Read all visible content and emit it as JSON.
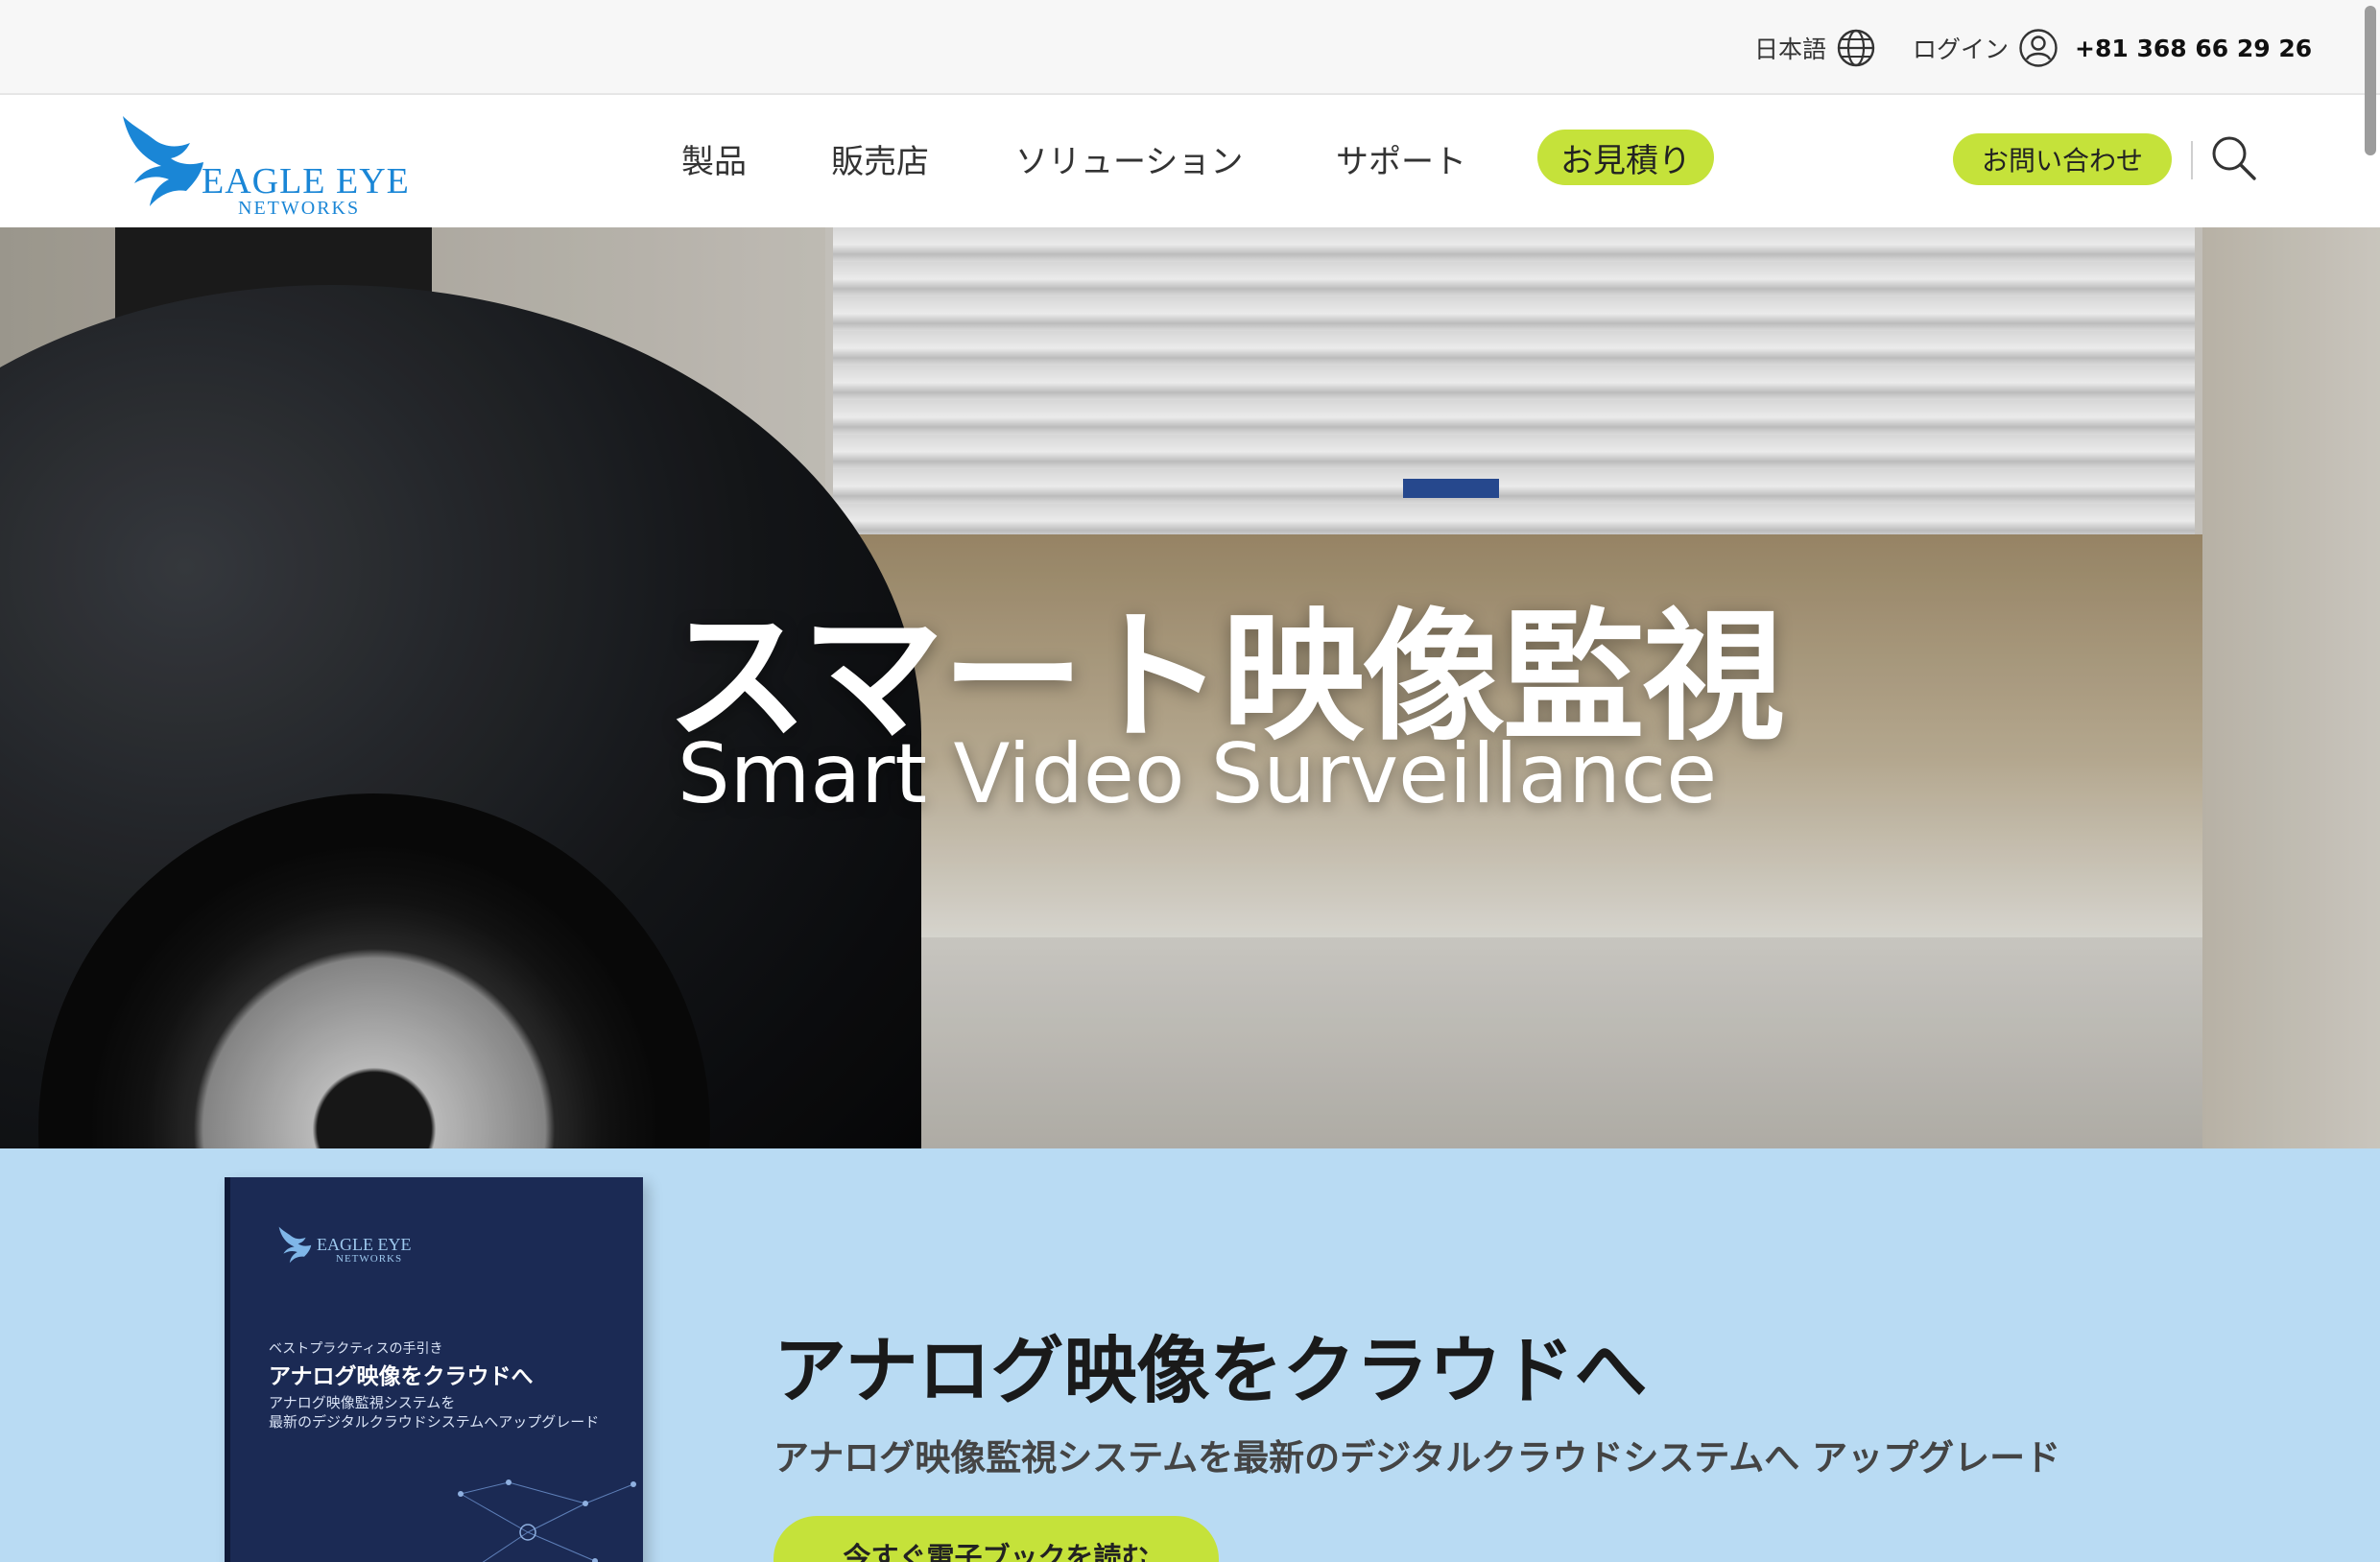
{
  "utility": {
    "language": "日本語",
    "login": "ログイン",
    "phone": "+81 368 66 29 26"
  },
  "brand": {
    "line1": "EAGLE EYE",
    "line2": "NETWORKS",
    "color": "#1a86d6"
  },
  "nav": {
    "items": [
      "製品",
      "販売店",
      "ソリューション",
      "サポート"
    ],
    "quote": "お見積り",
    "contact": "お問い合わせ",
    "accent": "#c5e23a"
  },
  "hero": {
    "title_jp": "スマート映像監視",
    "title_en": "Smart Video Surveillance"
  },
  "ebook": {
    "cover": {
      "brand_line1": "EAGLE EYE",
      "brand_line2": "NETWORKS",
      "kicker": "ベストプラクティスの手引き",
      "title": "アナログ映像をクラウドへ",
      "sub1": "アナログ映像監視システムを",
      "sub2": "最新のデジタルクラウドシステムへアップグレード"
    },
    "title": "アナログ映像をクラウドへ",
    "subtitle": "アナログ映像監視システムを最新のデジタルクラウドシステムへ アップグレード",
    "cta": "今すぐ電子ブックを読む",
    "background": "#b9dbf3"
  }
}
